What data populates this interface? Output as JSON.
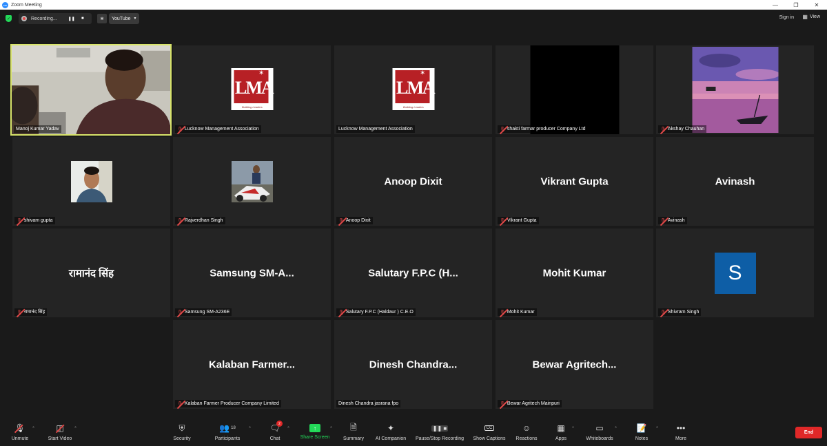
{
  "window": {
    "title": "Zoom Meeting",
    "app_icon": "zm"
  },
  "topbar": {
    "recording_label": "Recording...",
    "stream_label": "YouTube",
    "sign_in": "Sign in",
    "view": "View"
  },
  "tiles": [
    {
      "name": "Manoj Kumar Yadav",
      "type": "video",
      "active": true
    },
    {
      "name": "Lucknow Management Association",
      "type": "logo"
    },
    {
      "name": "Lucknow Management Association",
      "type": "logo"
    },
    {
      "name": "shakti farmar producer Company Ltd",
      "type": "black"
    },
    {
      "name": "Akshay Chauhan",
      "type": "sunset"
    },
    {
      "name": "shivam gupta",
      "type": "photo"
    },
    {
      "name": "Rajverdhan Singh",
      "type": "photo"
    },
    {
      "name": "Anoop Dixit",
      "display": "Anoop Dixit",
      "type": "text"
    },
    {
      "name": "Vikrant Gupta",
      "display": "Vikrant Gupta",
      "type": "text"
    },
    {
      "name": "Avinash",
      "display": "Avinash",
      "type": "text"
    },
    {
      "name": "रामानंद सिंह",
      "display": "रामानंद सिंह",
      "type": "text"
    },
    {
      "name": "Samsung SM-A236E",
      "display": "Samsung  SM-A...",
      "type": "text"
    },
    {
      "name": "Salutary F.P.C (Haldaur ) C.E.O",
      "display": "Salutary F.P.C (H...",
      "type": "text"
    },
    {
      "name": "Mohit Kumar",
      "display": "Mohit Kumar",
      "type": "text"
    },
    {
      "name": "Shivram Singh",
      "display": "S",
      "type": "initial"
    },
    {
      "name": "Kalaban Farmer Producer Company Limited",
      "display": "Kalaban  Farmer...",
      "type": "text"
    },
    {
      "name": "Dinesh Chandra jasrana fpo",
      "display": "Dinesh  Chandra...",
      "type": "text"
    },
    {
      "name": "Bewar Agritech Mainpuri",
      "display": "Bewar  Agritech...",
      "type": "text"
    }
  ],
  "logo": {
    "text": "LMA",
    "tagline": "Building Leaders"
  },
  "toolbar": {
    "unmute": "Unmute",
    "start_video": "Start Video",
    "security": "Security",
    "participants": "Participants",
    "participants_count": "18",
    "chat": "Chat",
    "chat_badge": "2",
    "share_screen": "Share Screen",
    "summary": "Summary",
    "ai_companion": "AI Companion",
    "pause_stop_recording": "Pause/Stop Recording",
    "show_captions": "Show Captions",
    "reactions": "Reactions",
    "apps": "Apps",
    "whiteboards": "Whiteboards",
    "notes": "Notes",
    "more": "More",
    "end": "End"
  },
  "colors": {
    "active_speaker_border": "#d8e46a",
    "share_green": "#23d959",
    "end_red": "#e02828",
    "tile_bg": "#242424",
    "initial_avatar": "#0e5ea6"
  }
}
